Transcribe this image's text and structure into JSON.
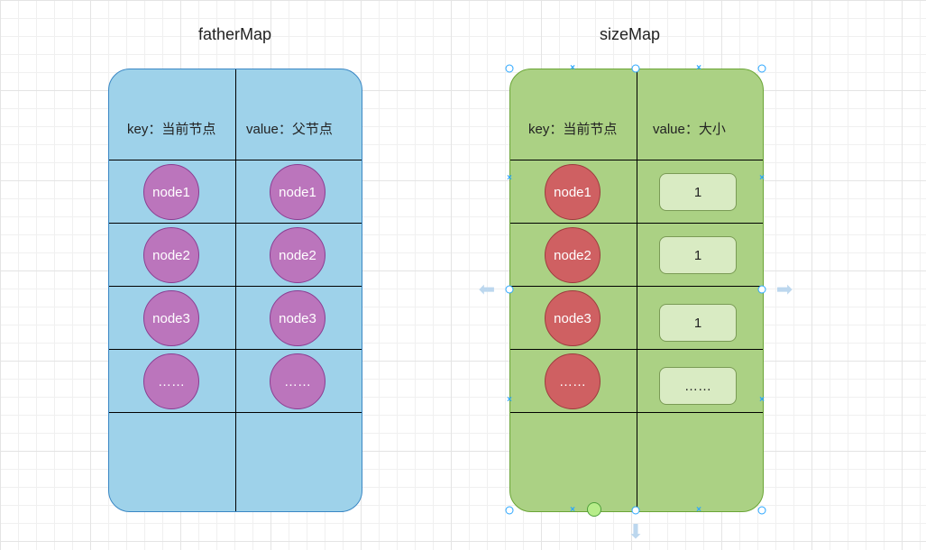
{
  "fatherMap": {
    "title": "fatherMap",
    "keyHeader": "key：当前节点",
    "valueHeader": "value：父节点",
    "rows": [
      {
        "key": "node1",
        "value": "node1"
      },
      {
        "key": "node2",
        "value": "node2"
      },
      {
        "key": "node3",
        "value": "node3"
      },
      {
        "key": "……",
        "value": "……"
      }
    ]
  },
  "sizeMap": {
    "title": "sizeMap",
    "keyHeader": "key：当前节点",
    "valueHeader": "value：大小",
    "rows": [
      {
        "key": "node1",
        "value": "1"
      },
      {
        "key": "node2",
        "value": "1"
      },
      {
        "key": "node3",
        "value": "1"
      },
      {
        "key": "……",
        "value": "……"
      }
    ]
  },
  "colors": {
    "panelBlue": "#9ed2ea",
    "panelGreen": "#abd184",
    "nodePurple": "#bb75bc",
    "nodeRed": "#cf6062",
    "pill": "#d9ebc3"
  },
  "selection": {
    "target": "sizeMap-panel",
    "selected": true
  }
}
